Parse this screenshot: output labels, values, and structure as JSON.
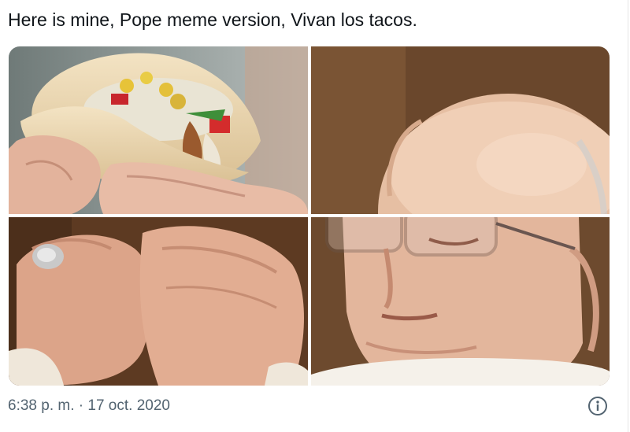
{
  "tweet": {
    "text": "Here is mine, Pope meme version, Vivan los tacos.",
    "media": [
      {
        "panel": "top-left",
        "alt": ""
      },
      {
        "panel": "top-right",
        "alt": ""
      },
      {
        "panel": "bottom-left",
        "alt": ""
      },
      {
        "panel": "bottom-right",
        "alt": ""
      }
    ],
    "timestamp": "6:38 p. m. · 17 oct. 2020"
  },
  "icons": {
    "info": "info-circle-icon"
  },
  "colors": {
    "text_primary": "#0f1419",
    "text_secondary": "#536471",
    "taco_background": "#8c9594",
    "pope_background": "#6d4a2e"
  }
}
